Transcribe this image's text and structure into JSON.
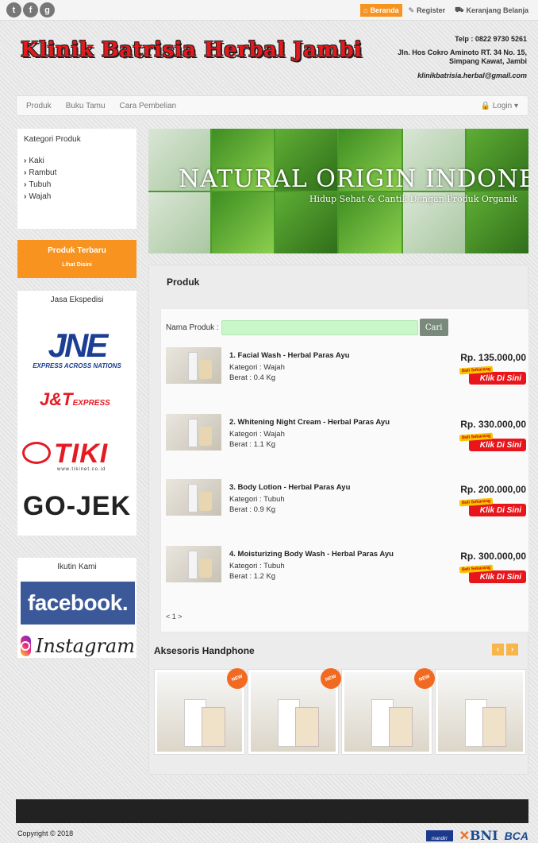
{
  "topbar": {
    "social": [
      "t",
      "f",
      "g"
    ],
    "nav": [
      {
        "label": "Beranda",
        "icon": "home-icon",
        "active": true
      },
      {
        "label": "Register",
        "icon": "edit-icon",
        "active": false
      },
      {
        "label": "Keranjang Belanja",
        "icon": "cart-icon",
        "active": false
      }
    ]
  },
  "header": {
    "logo": "Klinik Batrisia Herbal Jambi",
    "phone": "Telp : 0822 9730 5261",
    "address": "Jln. Hos Cokro Aminoto RT. 34 No. 15, Simpang Kawat, Jambi",
    "email": "klinikbatrisia.herbal@gmail.com"
  },
  "navbar": {
    "links": [
      "Produk",
      "Buku Tamu",
      "Cara Pembelian"
    ],
    "login": "Login"
  },
  "sidebar": {
    "category_title": "Kategori Produk",
    "categories": [
      "Kaki",
      "Rambut",
      "Tubuh",
      "Wajah"
    ],
    "terbaru_title": "Produk Terbaru",
    "terbaru_link": "Lihat Disini",
    "ekspedisi_title": "Jasa Ekspedisi",
    "jne": "JNE",
    "jne_tagline": "EXPRESS ACROSS NATIONS",
    "jt": "J&T",
    "jt_sub": "EXPRESS",
    "tiki": "TIKI",
    "tiki_url": "www.tikinet.co.id",
    "gojek": "GO-JEK",
    "follow_title": "Ikutin Kami",
    "facebook": "facebook.",
    "instagram": "Instagram"
  },
  "banner": {
    "title": "NATURAL ORIGIN INDONESIA",
    "subtitle": "Hidup Sehat & Cantik Dengan Produk Organik"
  },
  "main": {
    "heading": "Produk",
    "search_label": "Nama Produk :",
    "search_value": "",
    "search_button": "Cari",
    "products": [
      {
        "name": "1. Facial Wash - Herbal Paras Ayu",
        "category": "Kategori : Wajah",
        "weight": "Berat : 0.4 Kg",
        "price": "Rp. 135.000,00"
      },
      {
        "name": "2. Whitening Night Cream - Herbal Paras Ayu",
        "category": "Kategori : Wajah",
        "weight": "Berat : 1.1 Kg",
        "price": "Rp. 330.000,00"
      },
      {
        "name": "3. Body Lotion - Herbal Paras Ayu",
        "category": "Kategori : Tubuh",
        "weight": "Berat : 0.9 Kg",
        "price": "Rp. 200.000,00"
      },
      {
        "name": "4. Moisturizing Body Wash - Herbal Paras Ayu",
        "category": "Kategori : Tubuh",
        "weight": "Berat : 1.2 Kg",
        "price": "Rp. 300.000,00"
      }
    ],
    "buy_badge": "Beli Sekarang",
    "buy_button": "Klik Di Sini",
    "pager": "< 1 >",
    "aksesoris_title": "Aksesoris Handphone",
    "new_badge": "NEW"
  },
  "footer": {
    "copyright": "Copyright © 2018",
    "banks": [
      "mandiri",
      "BNI",
      "BCA"
    ]
  },
  "colors": {
    "accent": "#f7931e",
    "logo": "#e5191c",
    "price_button": "#e8151b"
  }
}
